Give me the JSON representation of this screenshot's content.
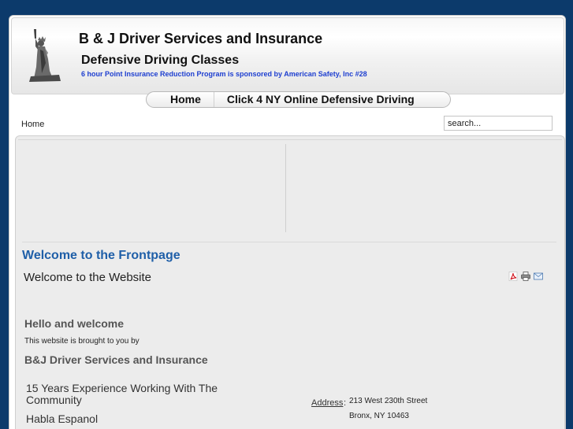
{
  "header": {
    "title": "B & J Driver Services and Insurance",
    "subtitle": "Defensive Driving Classes",
    "tagline": "6 hour Point Insurance Reduction Program is sponsored by American Safety, Inc #28"
  },
  "nav": {
    "items": [
      {
        "label": "Home"
      },
      {
        "label": "Click 4 NY Online Defensive Driving"
      }
    ]
  },
  "breadcrumb": "Home",
  "search": {
    "placeholder": "search..."
  },
  "article": {
    "title": "Welcome to the Frontpage",
    "subtitle": "Welcome to the Website",
    "hello": "Hello and welcome",
    "brought": "This website is brought to you by",
    "company": "B&J Driver Services and Insurance",
    "experience": "15 Years Experience Working With The Community",
    "habla": "Habla Espanol",
    "address_label": "Address",
    "address_line1": "213 West 230th Street",
    "address_line2": "Bronx, NY  10463"
  },
  "icons": [
    "pdf-icon",
    "print-icon",
    "email-icon"
  ],
  "colors": {
    "background": "#0c3a6b",
    "title_blue": "#1f5fa8",
    "tagline_blue": "#1e3fd0"
  }
}
